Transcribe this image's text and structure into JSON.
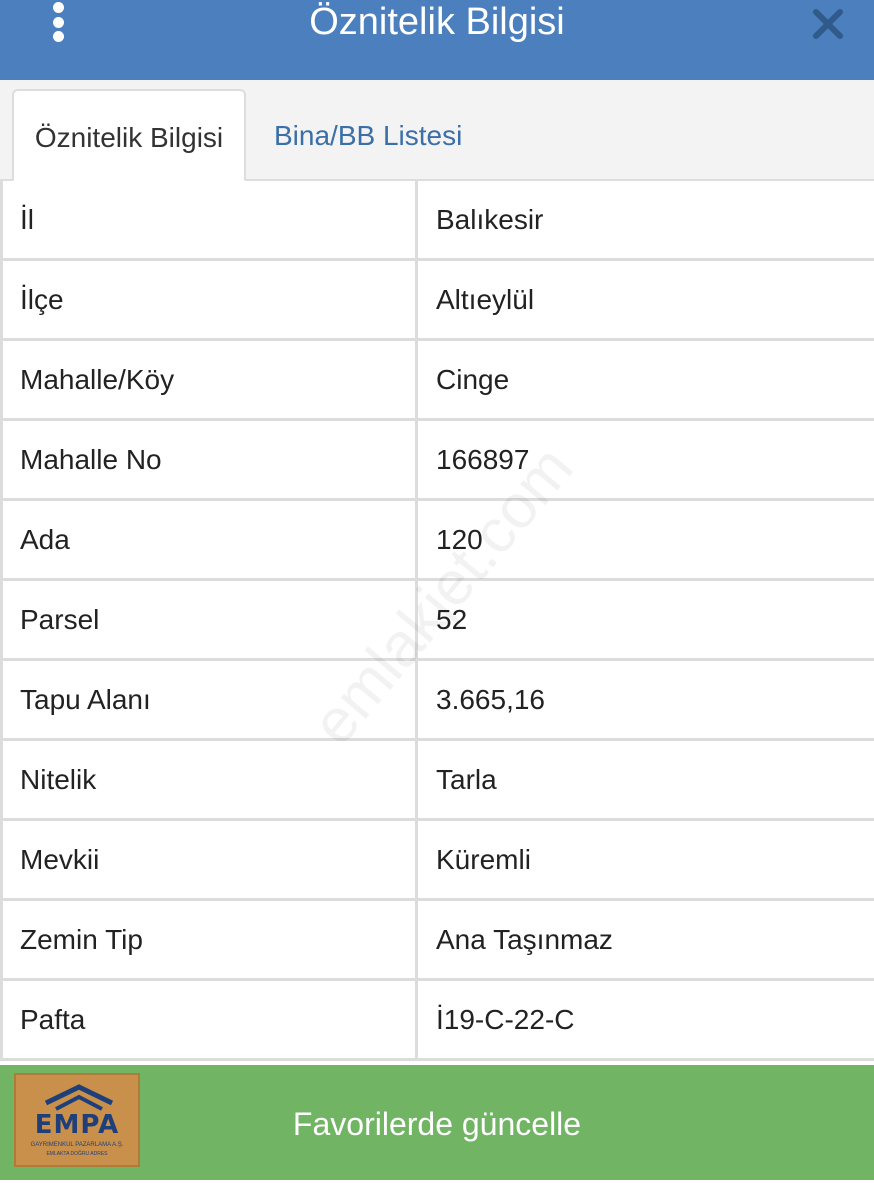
{
  "header": {
    "title": "Öznitelik Bilgisi",
    "menu_icon": "more-vertical-icon",
    "close_icon": "close-icon",
    "background_color": "#4b7fbd"
  },
  "tabs": [
    {
      "label": "Öznitelik Bilgisi",
      "active": true
    },
    {
      "label": "Bina/BB Listesi",
      "active": false
    }
  ],
  "attributes": [
    {
      "key": "İl",
      "value": "Balıkesir"
    },
    {
      "key": "İlçe",
      "value": "Altıeylül"
    },
    {
      "key": "Mahalle/Köy",
      "value": "Cinge"
    },
    {
      "key": "Mahalle No",
      "value": "166897"
    },
    {
      "key": "Ada",
      "value": "120"
    },
    {
      "key": "Parsel",
      "value": "52"
    },
    {
      "key": "Tapu Alanı",
      "value": "3.665,16"
    },
    {
      "key": "Nitelik",
      "value": "Tarla"
    },
    {
      "key": "Mevkii",
      "value": "Küremli"
    },
    {
      "key": "Zemin Tip",
      "value": "Ana Taşınmaz"
    },
    {
      "key": "Pafta",
      "value": "İ19-C-22-C"
    }
  ],
  "watermark": "emlakjet.com",
  "logo": {
    "brand": "EMPA",
    "line1": "GAYRIMENKUL PAZARLAMA A.Ş.",
    "line2": "EMLAKTA DOĞRU ADRES"
  },
  "footer": {
    "update_button_label": "Favorilerde güncelle",
    "background_color": "#71b463"
  }
}
